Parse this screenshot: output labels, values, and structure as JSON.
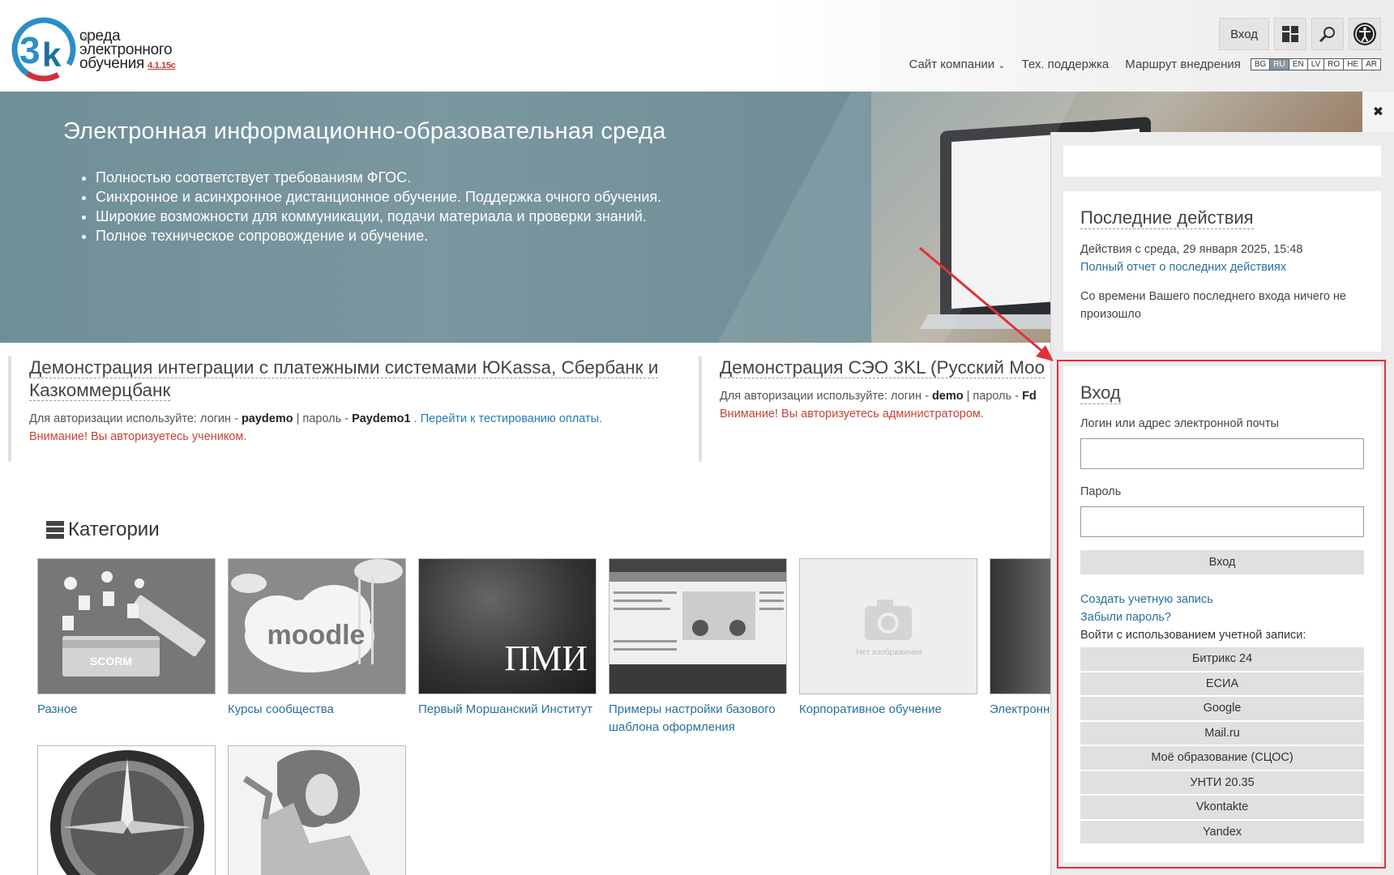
{
  "header": {
    "logo_text_1": "среда",
    "logo_text_2": "электронного",
    "logo_text_3": "обучения",
    "logo_version": "4.1.15c",
    "logo_reg": "®",
    "login_button": "Вход",
    "nav": {
      "company_site": "Сайт компании",
      "support": "Тех. поддержка",
      "route": "Маршрут внедрения"
    },
    "languages": [
      "BG",
      "RU",
      "EN",
      "LV",
      "RO",
      "HE",
      "AR"
    ],
    "active_language": "RU"
  },
  "hero": {
    "title": "Электронная информационно-образовательная среда",
    "bullets": [
      "Полностью соответствует требованиям ФГОС.",
      "Синхронное и асинхронное дистанционное обучение. Поддержка очного обучения.",
      "Широкие возможности для коммуникации, подачи материала и проверки знаний.",
      "Полное техническое сопровождение и обучение."
    ]
  },
  "demos": [
    {
      "title": "Демонстрация интеграции с платежными системами ЮKassa, Сбербанк и Казкоммерцбанк",
      "prefix": "Для авторизации используйте: логин - ",
      "login": "paydemo",
      "mid": " | пароль - ",
      "password": "Paydemo1",
      "sep": " . ",
      "link": "Перейти к тестированию оплаты.",
      "warning": "Внимание! Вы авторизуетесь учеником."
    },
    {
      "title": "Демонстрация СЭО 3KL (Русский Moo",
      "prefix": "Для авторизации используйте: логин - ",
      "login": "demo",
      "mid": " | пароль - ",
      "password": "Fd",
      "warning": "Внимание! Вы авторизуетесь администратором."
    }
  ],
  "categories": {
    "heading": "Категории",
    "items": [
      {
        "label": "Разное",
        "image_text": "SCORM"
      },
      {
        "label": "Курсы сообщества",
        "image_text": "moodle"
      },
      {
        "label": "Первый Моршанский Институт",
        "image_text": "ПМИ"
      },
      {
        "label": "Примеры настройки базового шаблона оформления",
        "image_text": ""
      },
      {
        "label": "Корпоративное обучение",
        "image_text": "Нет изображения"
      },
      {
        "label": "Электронн",
        "image_text": ""
      }
    ]
  },
  "drawer": {
    "close": "✖",
    "recent": {
      "title": "Последние действия",
      "since": "Действия с среда, 29 января 2025, 15:48",
      "full_report": "Полный отчет о последних действиях",
      "nothing": "Со времени Вашего последнего входа ничего не произошло"
    },
    "login": {
      "title": "Вход",
      "username_label": "Логин или адрес электронной почты",
      "password_label": "Пароль",
      "submit": "Вход",
      "create_account": "Создать учетную запись",
      "forgot": "Забыли пароль?",
      "oauth_label": "Войти с использованием учетной записи:",
      "providers": [
        "Битрикс 24",
        "ЕСИА",
        "Google",
        "Mail.ru",
        "Моё образование (СЦОС)",
        "УНТИ 20.35",
        "Vkontakte",
        "Yandex"
      ]
    }
  },
  "colors": {
    "link": "#2a6f9e",
    "warning": "#c94236",
    "highlight_border": "#e0313a",
    "hero_overlay": "#6f8f98"
  }
}
